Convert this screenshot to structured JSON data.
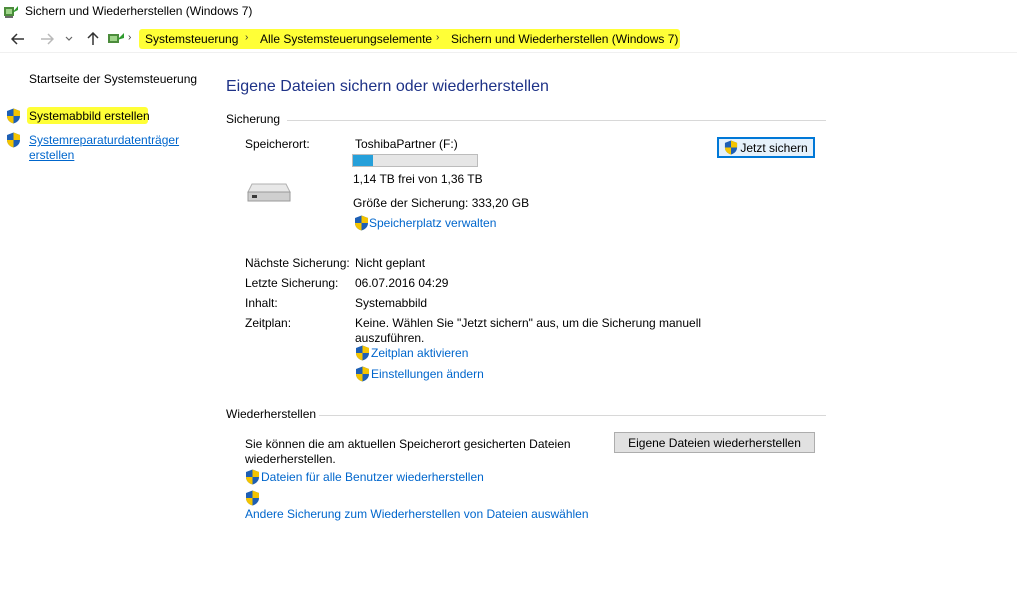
{
  "window": {
    "title": "Sichern und Wiederherstellen (Windows 7)"
  },
  "nav": {
    "back_icon": "back-arrow-icon",
    "forward_icon": "forward-arrow-icon",
    "recent_icon": "chevron-down-icon",
    "up_icon": "up-arrow-icon"
  },
  "address": {
    "separator": "›",
    "crumbs": [
      "Systemsteuerung",
      "Alle Systemsteuerungselemente",
      "Sichern und Wiederherstellen (Windows 7)"
    ],
    "highlight_color": "#ffff37"
  },
  "sidebar": {
    "home": "Startseite der Systemsteuerung",
    "items": [
      {
        "label": "Systemabbild erstellen"
      },
      {
        "label_line1": "Systemreparaturdatenträger",
        "label_line2": "erstellen"
      }
    ]
  },
  "main": {
    "heading": "Eigene Dateien sichern oder wiederherstellen",
    "backup": {
      "section_title": "Sicherung",
      "location_label": "Speicherort:",
      "location_value": "ToshibaPartner (F:)",
      "usage_fraction": 0.16,
      "free_text": "1,14 TB frei von 1,36 TB",
      "backup_size": "Größe der Sicherung: 333,20 GB",
      "manage_space": "Speicherplatz verwalten",
      "backup_now": "Jetzt sichern",
      "next_label": "Nächste Sicherung:",
      "next_value": "Nicht geplant",
      "last_label": "Letzte Sicherung:",
      "last_value": "06.07.2016 04:29",
      "content_label": "Inhalt:",
      "content_value": "Systemabbild",
      "schedule_label": "Zeitplan:",
      "schedule_line1": "Keine. Wählen Sie \"Jetzt sichern\" aus, um die Sicherung manuell",
      "schedule_line2": "auszuführen.",
      "activate_schedule": "Zeitplan aktivieren",
      "change_settings": "Einstellungen ändern"
    },
    "restore": {
      "section_title": "Wiederherstellen",
      "desc_line1": "Sie können die am aktuellen Speicherort gesicherten Dateien",
      "desc_line2": "wiederherstellen.",
      "restore_button": "Eigene Dateien wiederherstellen",
      "restore_all_users": "Dateien für alle Benutzer wiederherstellen",
      "choose_other": "Andere Sicherung zum Wiederherstellen von Dateien auswählen"
    }
  },
  "colors": {
    "link": "#0066cc",
    "heading": "#1e3287",
    "progress": "#26a0da",
    "accent": "#0078d7"
  }
}
